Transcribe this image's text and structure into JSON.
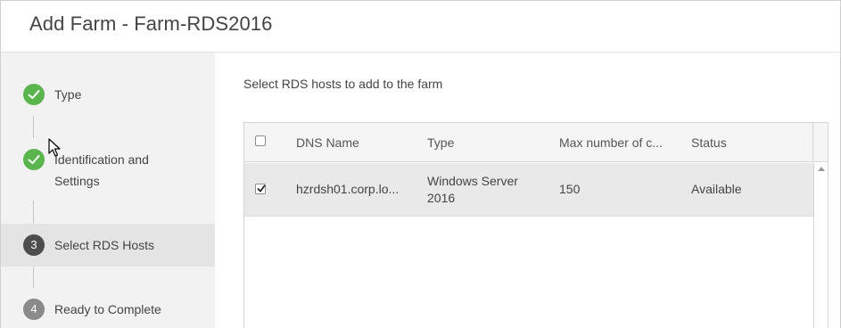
{
  "dialog": {
    "title": "Add Farm - Farm-RDS2016"
  },
  "wizard": {
    "steps": [
      {
        "number": "",
        "label": "Type",
        "state": "done"
      },
      {
        "number": "",
        "label_line1": "Identification and",
        "label_line2": "Settings",
        "state": "done"
      },
      {
        "number": "3",
        "label": "Select RDS Hosts",
        "state": "current"
      },
      {
        "number": "4",
        "label": "Ready to Complete",
        "state": "pending"
      }
    ]
  },
  "content": {
    "instruction": "Select RDS hosts to add to the farm"
  },
  "grid": {
    "columns": [
      "DNS Name",
      "Type",
      "Max number of c...",
      "Status"
    ],
    "rows": [
      {
        "selected": true,
        "dns_name": "hzrdsh01.corp.lo...",
        "type_line1": "Windows Server",
        "type_line2": "2016",
        "max_connections": "150",
        "status": "Available"
      }
    ]
  },
  "icons": {
    "done": "checkmark-icon",
    "scroll": "scroll-up-arrow-icon",
    "pointer": "mouse-pointer-icon"
  },
  "colors": {
    "done": "#5bb54d",
    "current": "#4d4d4d",
    "pending": "#8a8a8a",
    "selected_row": "#e9e9e9"
  }
}
